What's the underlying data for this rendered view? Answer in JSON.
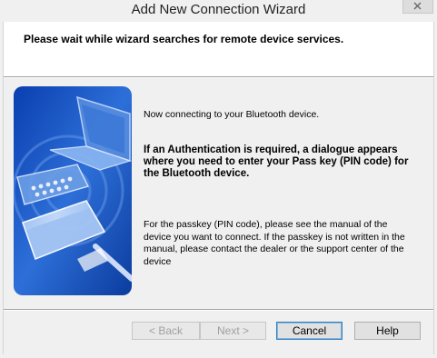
{
  "window": {
    "title": "Add New Connection Wizard"
  },
  "header": {
    "instruction": "Please wait while wizard searches for remote device services."
  },
  "content": {
    "status": "Now connecting to your Bluetooth device.",
    "auth_notice": "If an Authentication is required, a dialogue appears where you need to enter your Pass key (PIN code) for the Bluetooth device.",
    "passkey_help": "For the passkey (PIN code), please see the manual of the device you want to connect. If the passkey is not written in the manual, please contact the dealer or the support center of the device"
  },
  "buttons": {
    "back": "< Back",
    "next": "Next >",
    "cancel": "Cancel",
    "help": "Help"
  },
  "colors": {
    "accent": "#1a5fc8",
    "image_dark": "#0a3fa8"
  }
}
